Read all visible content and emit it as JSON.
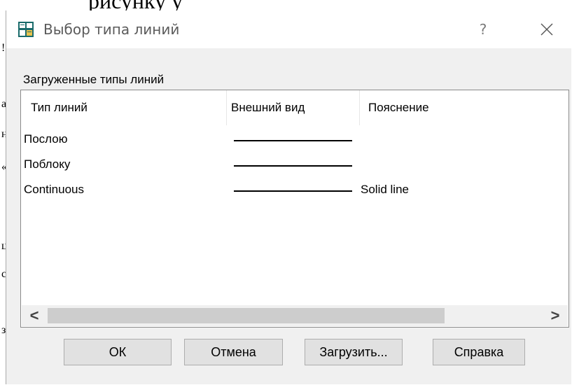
{
  "background": {
    "top_text": "рисунку у",
    "fragments": [
      "!",
      "а",
      "н",
      "«",
      "ц",
      "с",
      "з"
    ]
  },
  "dialog": {
    "title": "Выбор типа линий",
    "help_label": "?",
    "group_label": "Загруженные типы линий",
    "columns": [
      "Тип линий",
      "Внешний вид",
      "Пояснение"
    ],
    "rows": [
      {
        "name": "Послою",
        "description": ""
      },
      {
        "name": "Поблоку",
        "description": ""
      },
      {
        "name": "Continuous",
        "description": "Solid line"
      }
    ],
    "scroll_left": "<",
    "scroll_right": ">",
    "buttons": {
      "ok": "ОК",
      "cancel": "Отмена",
      "load": "Загрузить...",
      "help": "Справка"
    }
  },
  "colors": {
    "dialog_bg": "#f0f0f0",
    "title_bg": "#ffffff",
    "button_bg": "#e1e1e1"
  },
  "icons": [
    "linetype-app-icon",
    "close-icon",
    "chevron-left-icon",
    "chevron-right-icon"
  ]
}
